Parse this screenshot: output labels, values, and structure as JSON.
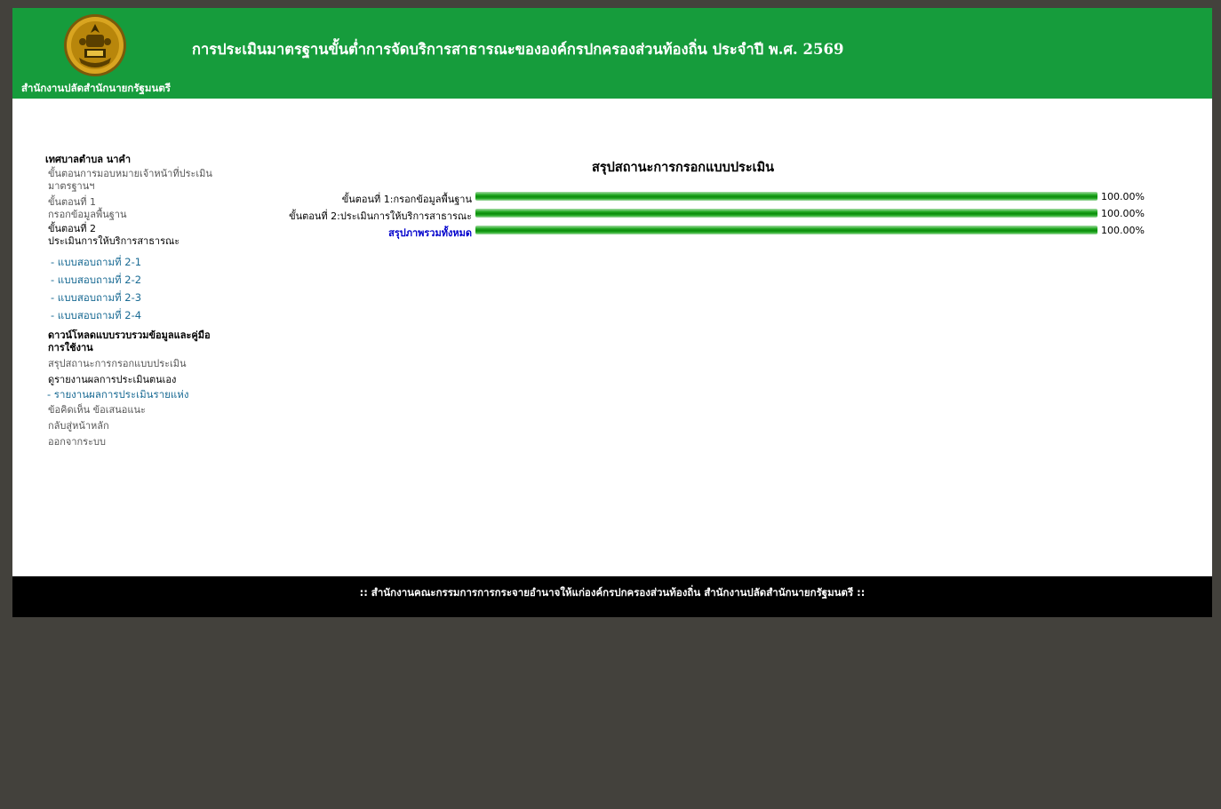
{
  "header": {
    "org_name": "สำนักงานปลัดสำนักนายกรัฐมนตรี",
    "site_title": "การประเมินมาตรฐานขั้นต่ำการจัดบริการสาธารณะขององค์กรปกครองส่วนท้องถิ่น ประจำปี พ.ศ. 2569"
  },
  "sidebar": {
    "org_title": "เทศบาลตำบล นาคำ",
    "delegate_link": "ขั้นตอนการมอบหมายเจ้าหน้าที่ประเมินมาตรฐานฯ",
    "step1_line1": "ขั้นตอนที่ 1",
    "step1_line2": "กรอกข้อมูลพื้นฐาน",
    "step2_line1": "ขั้นตอนที่ 2",
    "step2_line2": "ประเมินการให้บริการสาธารณะ",
    "questionnaires": [
      "- แบบสอบถามที่ 2-1",
      "- แบบสอบถามที่ 2-2",
      "- แบบสอบถามที่ 2-3",
      "- แบบสอบถามที่ 2-4"
    ],
    "download_head": "ดาวน์โหลดแบบรวบรวมข้อมูลและคู่มือการใช้งาน",
    "summary_link": "สรุปสถานะการกรอกแบบประเมิน",
    "self_report_head": "ดูรายงานผลการประเมินตนเอง",
    "report_link": "- รายงานผลการประเมินรายแห่ง",
    "feedback_link": "ข้อคิดเห็น ข้อเสนอแนะ",
    "home_link": "กลับสู่หน้าหลัก",
    "logout_link": "ออกจากระบบ"
  },
  "summary": {
    "title": "สรุปสถานะการกรอกแบบประเมิน",
    "rows": [
      {
        "label": "ขั้นตอนที่ 1:กรอกข้อมูลพื้นฐาน",
        "value": "100.00%",
        "fraction": 1.0
      },
      {
        "label": "ขั้นตอนที่ 2:ประเมินการให้บริการสาธารณะ",
        "value": "100.00%",
        "fraction": 1.0
      },
      {
        "label": "สรุปภาพรวมทั้งหมด",
        "value": "100.00%",
        "fraction": 1.0
      }
    ]
  },
  "footer": {
    "text": ":: สำนักงานคณะกรรมการการกระจายอำนาจให้แก่องค์กรปกครองส่วนท้องถิ่น สำนักงานปลัดสำนักนายกรัฐมนตรี ::"
  },
  "colors": {
    "header_bg": "#169c3c",
    "page_bg": "#43413c",
    "link_blue": "#1a6b94",
    "total_label": "#0000cc",
    "footer_bg": "#000000"
  }
}
